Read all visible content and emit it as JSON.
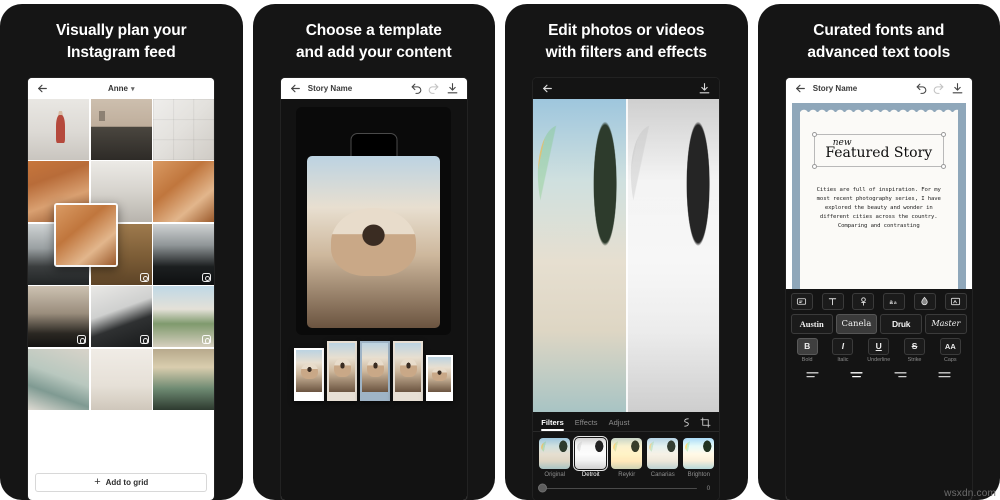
{
  "watermark": "wsxdn.com",
  "panels": [
    {
      "id": "plan-feed",
      "title": "Visually plan your\nInstagram feed",
      "appbar": {
        "title": "Anne",
        "chevron": "chevron-down-icon",
        "back": "back-arrow-icon"
      },
      "add_button": {
        "label": "Add to grid",
        "icon": "plus-icon"
      },
      "grid_badges": "instagram-badge"
    },
    {
      "id": "choose-template",
      "title": "Choose a template\nand add your content",
      "appbar": {
        "title": "Story Name",
        "back": "back-arrow-icon",
        "undo": "undo-icon",
        "redo": "redo-icon",
        "download": "download-icon"
      },
      "templates": [
        "template-1",
        "template-2",
        "template-3",
        "template-4",
        "template-5"
      ]
    },
    {
      "id": "edit-photos",
      "title": "Edit photos or videos\nwith filters and effects",
      "appbar": {
        "back": "back-arrow-icon",
        "download": "download-icon"
      },
      "tabs": [
        {
          "label": "Filters",
          "active": true
        },
        {
          "label": "Effects",
          "active": false
        },
        {
          "label": "Adjust",
          "active": false
        }
      ],
      "tools": [
        "magic-wand-icon",
        "crop-icon"
      ],
      "filters": [
        {
          "name": "Original",
          "selected": false
        },
        {
          "name": "Detroit",
          "selected": true
        },
        {
          "name": "Reykir",
          "selected": false
        },
        {
          "name": "Canarias",
          "selected": false
        },
        {
          "name": "Brighton",
          "selected": false
        }
      ],
      "slider": {
        "value": "0"
      }
    },
    {
      "id": "fonts-text-tools",
      "title": "Curated fonts and\nadvanced text tools",
      "appbar": {
        "title": "Story Name",
        "back": "back-arrow-icon",
        "undo": "undo-icon",
        "redo": "redo-icon",
        "download": "download-icon"
      },
      "text_card": {
        "kicker": "new",
        "headline": "Featured Story",
        "body": "Cities are full of inspiration. For my most recent photography series, I have explored the beauty and wonder in different cities across the country. Comparing and contrasting"
      },
      "tool_icons": [
        "text-box-icon",
        "text-type-icon",
        "text-color-icon",
        "letter-case-icon",
        "opacity-icon",
        "text-background-icon"
      ],
      "fonts": [
        {
          "name": "Austin",
          "selected": false
        },
        {
          "name": "Canela",
          "selected": true
        },
        {
          "name": "Druk",
          "selected": false
        },
        {
          "name": "Master",
          "selected": false
        }
      ],
      "styles": [
        {
          "glyph": "B",
          "label": "Bold",
          "selected": true
        },
        {
          "glyph": "I",
          "label": "Italic",
          "selected": false
        },
        {
          "glyph": "U",
          "label": "Underline",
          "selected": false
        },
        {
          "glyph": "S",
          "label": "Strike",
          "selected": false
        },
        {
          "glyph": "AA",
          "label": "Caps",
          "selected": false
        }
      ],
      "alignments": [
        "align-left-icon",
        "align-center-icon",
        "align-right-icon",
        "align-justify-icon"
      ]
    }
  ]
}
